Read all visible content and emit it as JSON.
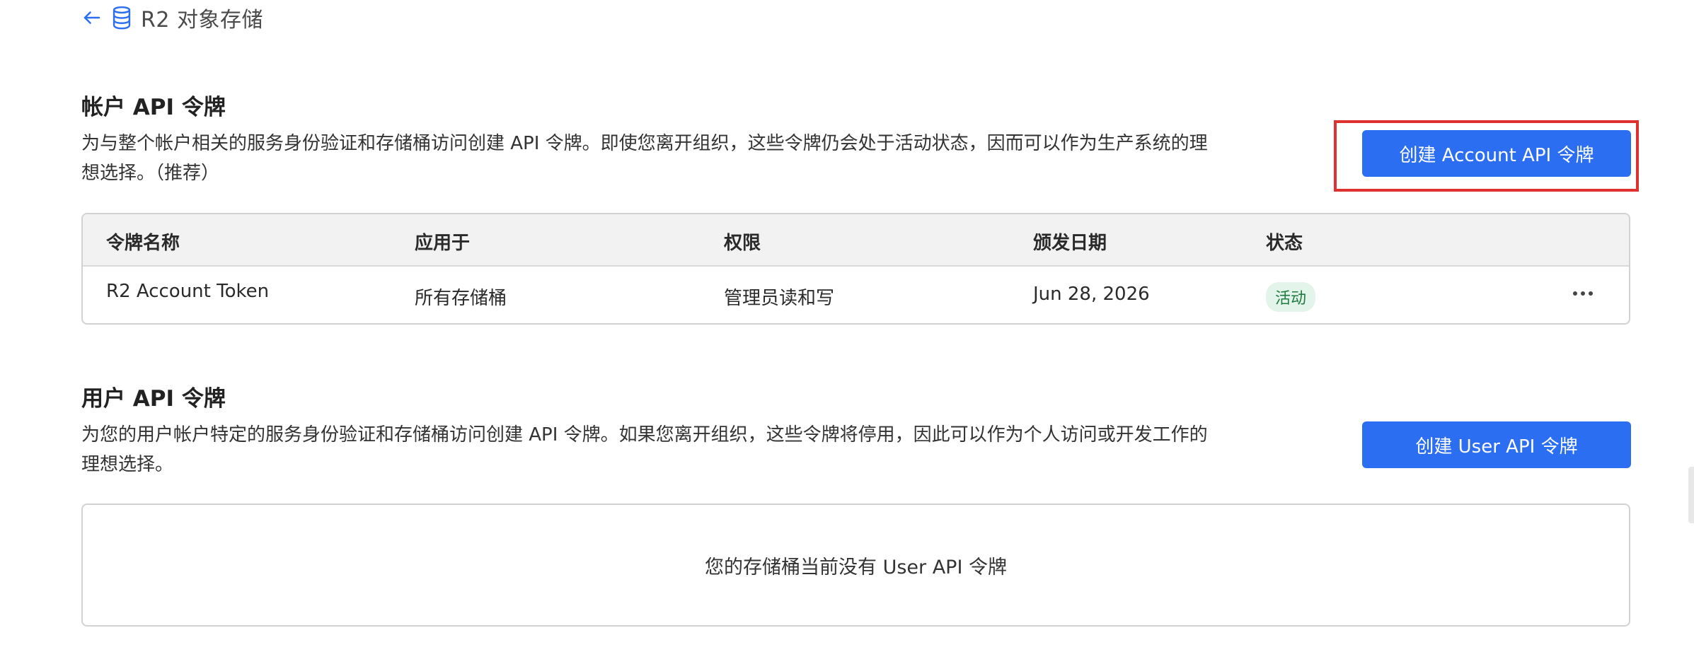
{
  "breadcrumb": {
    "back_icon": "arrow-left-icon",
    "db_icon": "database-icon",
    "label": "R2 对象存储"
  },
  "account_section": {
    "title": "帐户 API 令牌",
    "description": "为与整个帐户相关的服务身份验证和存储桶访问创建 API 令牌。即使您离开组织，这些令牌仍会处于活动状态，因而可以作为生产系统的理想选择。（推荐）",
    "create_button": "创建 Account API 令牌",
    "table": {
      "headers": [
        "令牌名称",
        "应用于",
        "权限",
        "颁发日期",
        "状态"
      ],
      "rows": [
        {
          "name": "R2 Account Token",
          "applies_to": "所有存储桶",
          "permission": "管理员读和写",
          "issued": "Jun 28, 2026",
          "status": "活动"
        }
      ]
    }
  },
  "user_section": {
    "title": "用户 API 令牌",
    "description": "为您的用户帐户特定的服务身份验证和存储桶访问创建 API 令牌。如果您离开组织，这些令牌将停用，因此可以作为个人访问或开发工作的理想选择。",
    "create_button": "创建 User API 令牌",
    "empty_message": "您的存储桶当前没有 User API 令牌"
  },
  "colors": {
    "accent": "#2c6ef2",
    "highlight": "#e03131",
    "status_bg": "#e3f5ea",
    "status_fg": "#1f7a3e"
  }
}
